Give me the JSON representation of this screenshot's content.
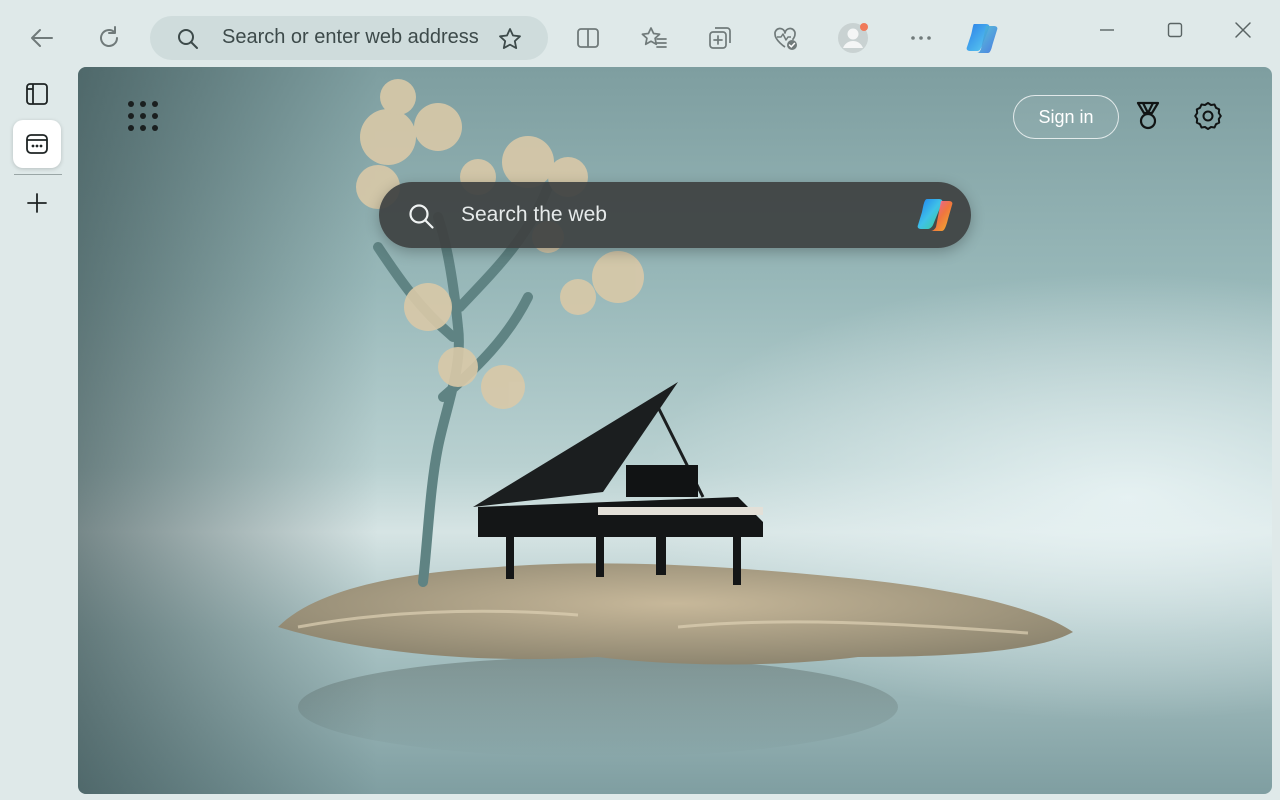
{
  "browser": {
    "toolbar": {
      "address_placeholder": "Search or enter web address"
    }
  },
  "newtab": {
    "signin_label": "Sign in",
    "search_placeholder": "Search the web"
  },
  "icons": {
    "back": "arrow-left-icon",
    "refresh": "refresh-icon",
    "search": "search-icon",
    "favorite": "star-icon",
    "split": "split-screen-icon",
    "favorites": "favorites-icon",
    "collections": "collections-icon",
    "health": "browser-essentials-icon",
    "profile": "profile-avatar-icon",
    "more": "more-options-icon",
    "copilot": "copilot-icon",
    "minimize": "minimize-icon",
    "maximize": "maximize-icon",
    "close": "close-icon",
    "tab_actions": "tab-actions-icon",
    "tab": "tab-icon",
    "new_tab": "plus-icon",
    "apps": "apps-grid-icon",
    "rewards": "rewards-icon",
    "settings": "gear-icon"
  },
  "colors": {
    "chrome_bg": "#dfe9e9",
    "address_bg": "#cfdcdc",
    "search_bg": "#3e4242",
    "profile_dot": "#f07a5a"
  }
}
